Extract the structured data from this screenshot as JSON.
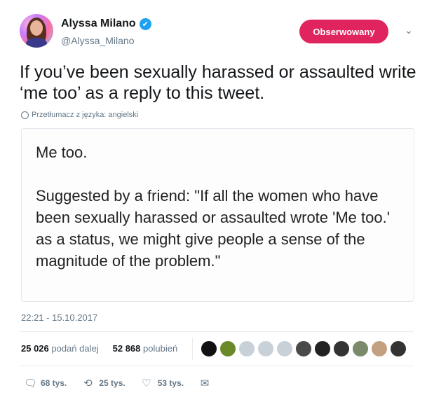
{
  "author": {
    "name": "Alyssa Milano",
    "handle": "@Alyssa_Milano",
    "verified_icon": "✔"
  },
  "follow_button": {
    "label": "Obserwowany",
    "color": "#e0245e"
  },
  "menu_caret": "⌄",
  "tweet": {
    "text": "If you’ve been sexually harassed or assaulted write ‘me too’ as a reply to this tweet.",
    "translate_label": "Przetłumacz z języka: angielski"
  },
  "media": {
    "text": "Me too.\n\nSuggested by a friend: \"If all the women who have been sexually harassed or assaulted wrote 'Me too.' as a status, we might give people a sense of the magnitude of the problem.\""
  },
  "timestamp": "22:21 - 15.10.2017",
  "stats": {
    "retweets_count": "25 026",
    "retweets_label": "podań dalej",
    "likes_count": "52 868",
    "likes_label": "polubień"
  },
  "liker_avatar_colors": [
    "#111111",
    "#6a8a2a",
    "#c9d1d8",
    "#c9d1d8",
    "#c9d1d8",
    "#4a4a4a",
    "#222222",
    "#333333",
    "#7a8a6a",
    "#c2a080",
    "#333333"
  ],
  "actions": {
    "reply_icon": "🗨",
    "reply_count": "68 tys.",
    "retweet_icon": "⟲",
    "retweet_count": "25 tys.",
    "like_icon": "♡",
    "like_count": "53 tys.",
    "dm_icon": "✉"
  }
}
